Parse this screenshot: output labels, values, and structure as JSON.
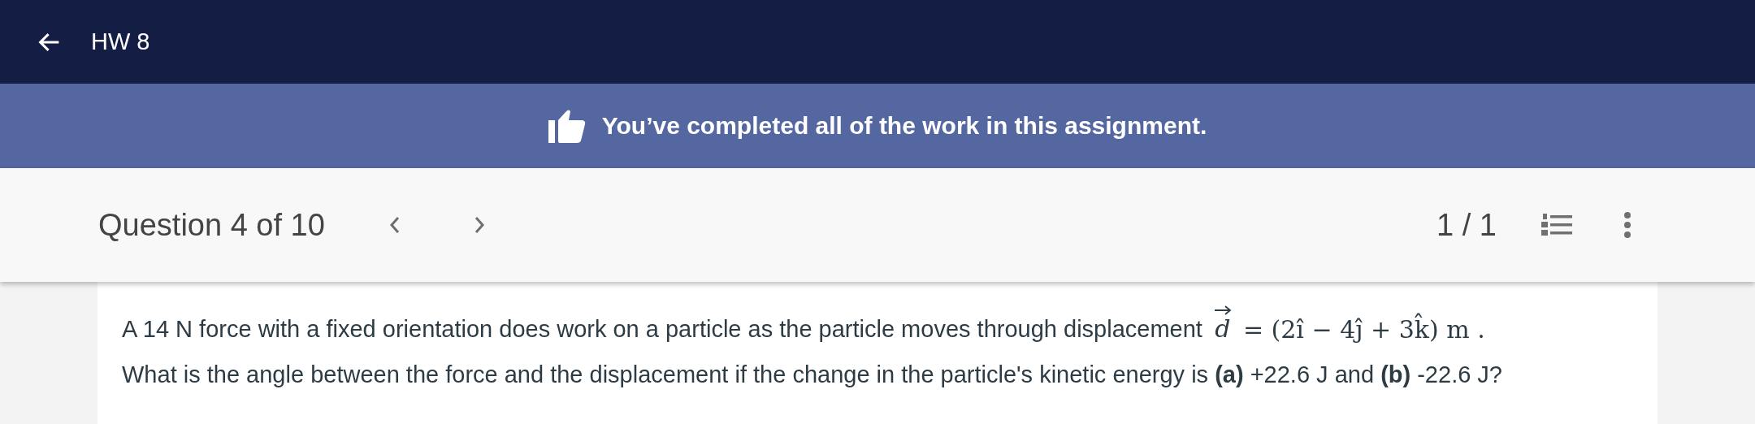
{
  "header": {
    "title": "HW 8"
  },
  "banner": {
    "message": "You’ve completed all of the work in this assignment."
  },
  "question_bar": {
    "position": "Question 4 of 10",
    "attempts": "1 / 1"
  },
  "question": {
    "text": "A 14 N force with a fixed orientation does work on a particle as the particle moves through displacement",
    "vector": "d",
    "equation": "= (2î − 4ĵ + 3k̂) m .",
    "prompt": "What is the angle between the force and the displacement if the change in the particle's kinetic energy is **(a)** +22.6 J and **(b)** -22.6 J?"
  }
}
